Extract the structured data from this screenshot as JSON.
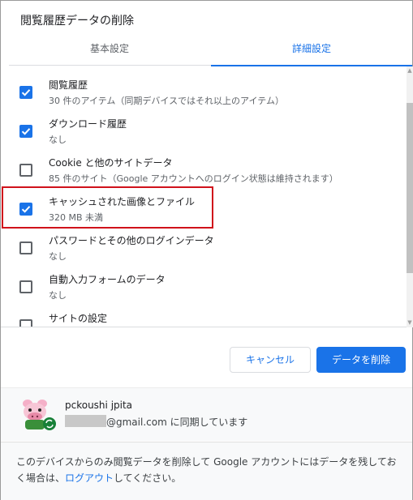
{
  "dialog": {
    "title": "閲覧履歴データの削除"
  },
  "tabs": [
    {
      "label": "基本設定",
      "active": false
    },
    {
      "label": "詳細設定",
      "active": true
    }
  ],
  "items": [
    {
      "label": "閲覧履歴",
      "sub": "30 件のアイテム（同期デバイスではそれ以上のアイテム）",
      "checked": true
    },
    {
      "label": "ダウンロード履歴",
      "sub": "なし",
      "checked": true
    },
    {
      "label": "Cookie と他のサイトデータ",
      "sub": "85 件のサイト（Google アカウントへのログイン状態は維持されます）",
      "checked": false
    },
    {
      "label": "キャッシュされた画像とファイル",
      "sub": "320 MB 未満",
      "checked": true
    },
    {
      "label": "パスワードとその他のログインデータ",
      "sub": "なし",
      "checked": false
    },
    {
      "label": "自動入力フォームのデータ",
      "sub": "なし",
      "checked": false
    },
    {
      "label": "サイトの設定",
      "sub": "",
      "checked": false
    }
  ],
  "buttons": {
    "cancel": "キャンセル",
    "delete": "データを削除"
  },
  "account": {
    "name": "pckoushi jpita",
    "email_suffix": "@gmail.com に同期しています"
  },
  "footer": {
    "text_before": "このデバイスからのみ閲覧データを削除して Google アカウントにはデータを残しておく場合は、",
    "link": "ログアウト",
    "text_after": "してください。"
  },
  "colors": {
    "accent": "#1a73e8",
    "highlight": "#d0121b"
  }
}
